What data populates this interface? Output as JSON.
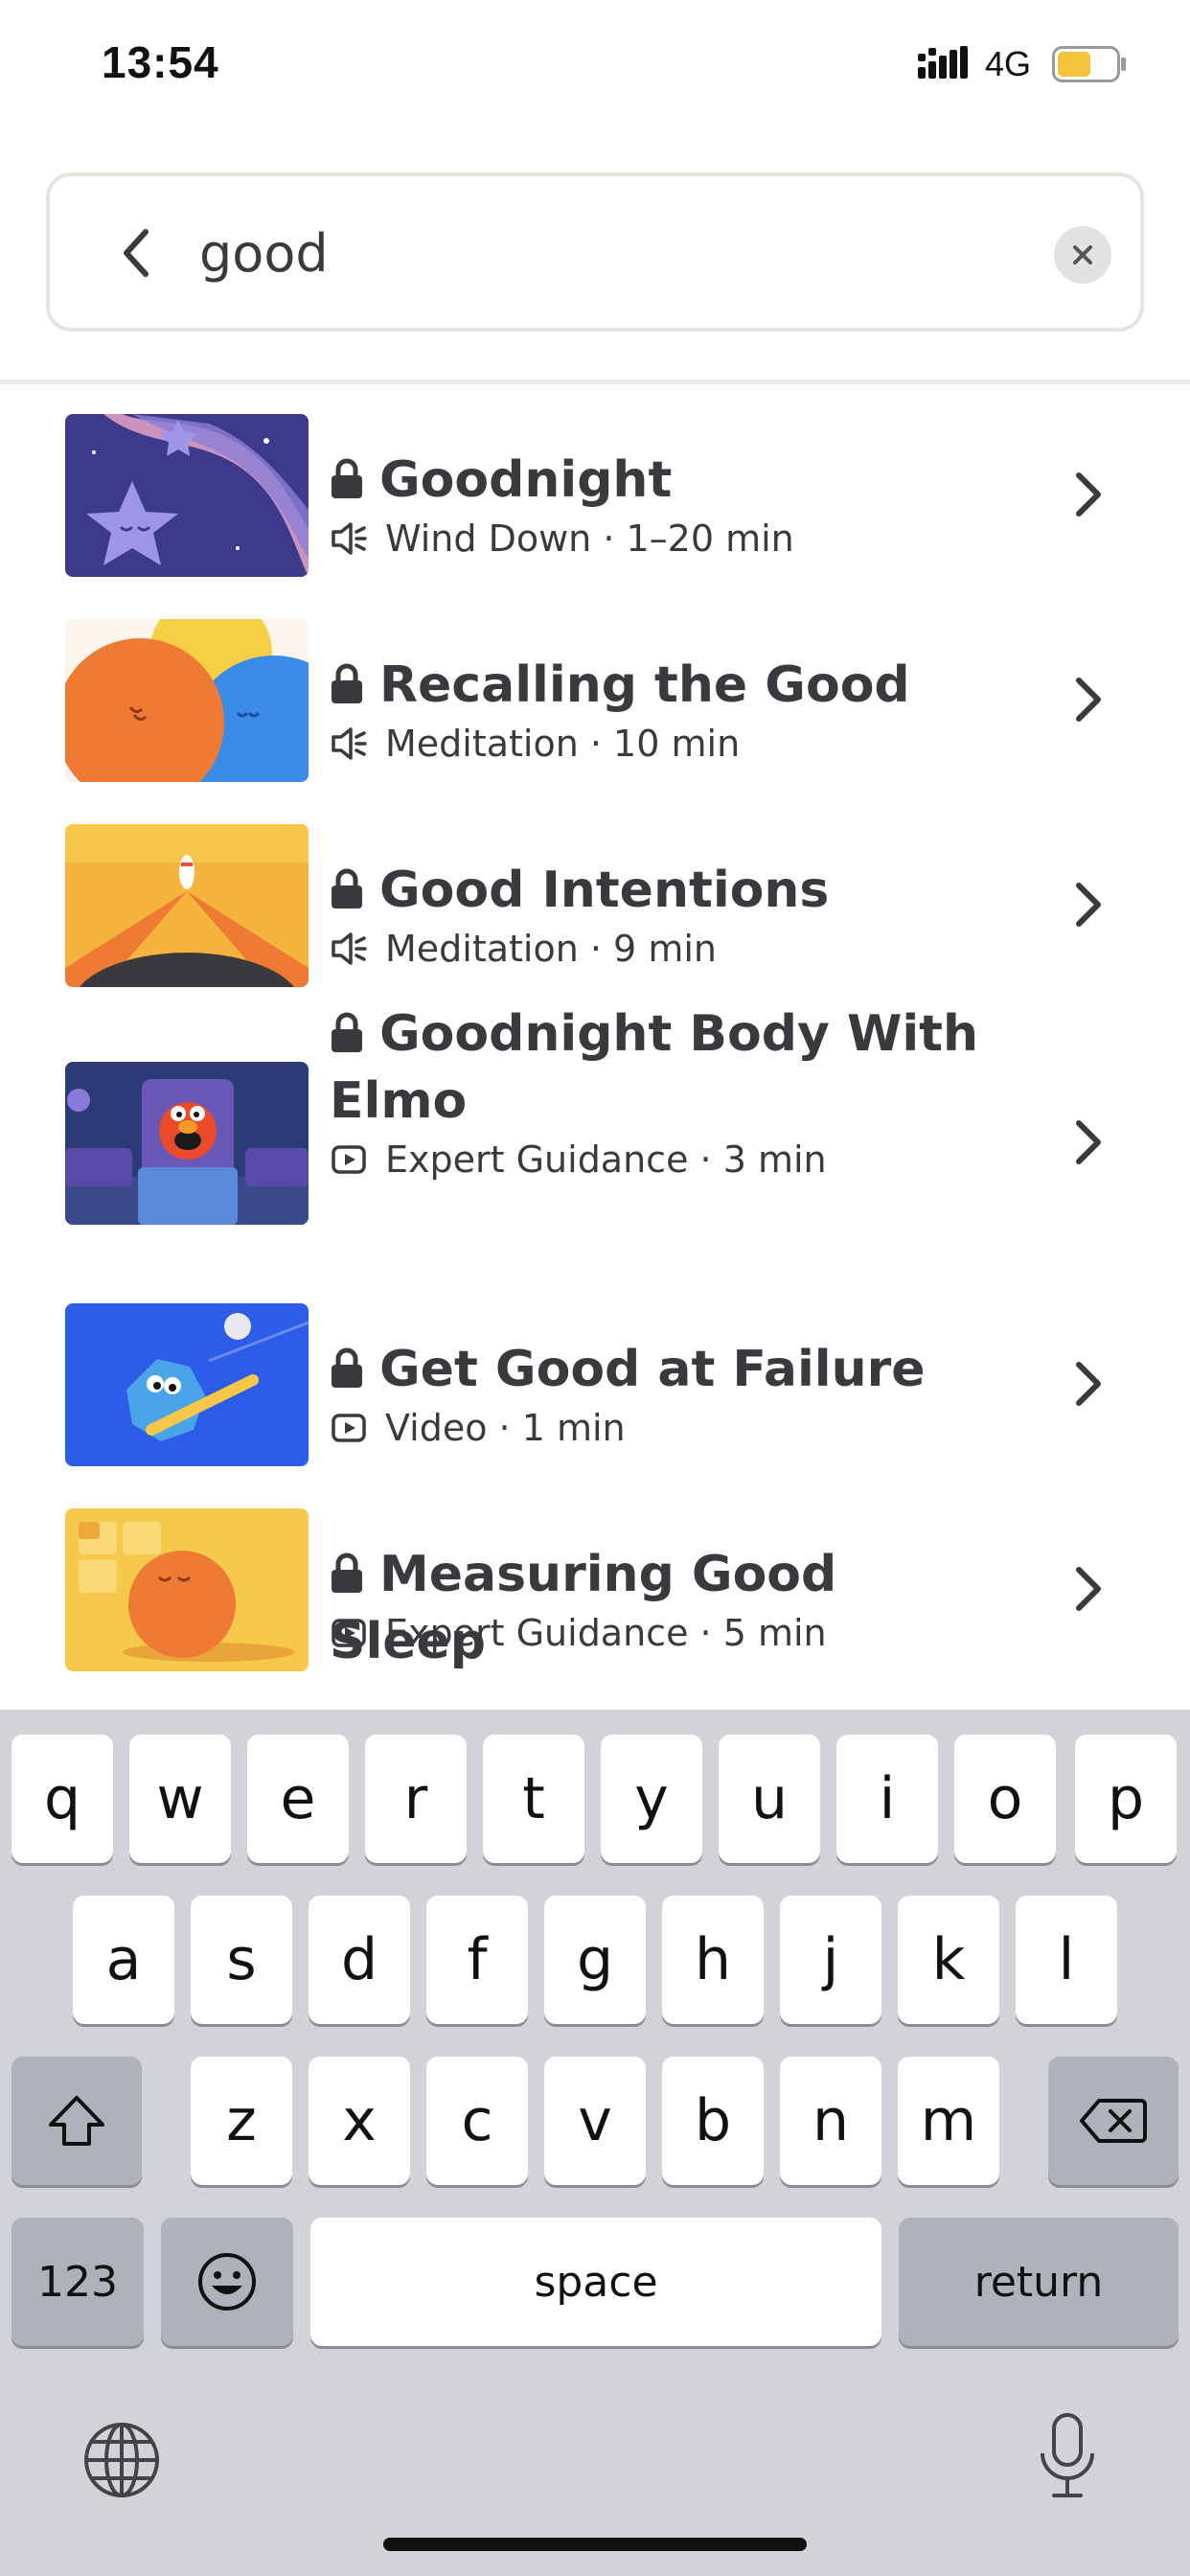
{
  "status_bar": {
    "time": "13:54",
    "network": "4G",
    "battery_color": "#f5c33b"
  },
  "search": {
    "query": "good",
    "back_icon": "chevron-left-icon",
    "clear_icon": "close-icon"
  },
  "results": [
    {
      "title": "Goodnight",
      "type_icon": "speaker-icon",
      "meta": "Wind Down · 1–20 min",
      "locked": true,
      "thumb": "goodnight"
    },
    {
      "title": "Recalling the Good",
      "type_icon": "speaker-icon",
      "meta": "Meditation · 10 min",
      "locked": true,
      "thumb": "recalling"
    },
    {
      "title": "Good Intentions",
      "type_icon": "speaker-icon",
      "meta": "Meditation · 9 min",
      "locked": true,
      "thumb": "intentions"
    },
    {
      "title": "Goodnight Body With Elmo",
      "type_icon": "play-icon",
      "meta": "Expert Guidance · 3 min",
      "locked": true,
      "thumb": "elmo"
    },
    {
      "title": "Get Good at Failure",
      "type_icon": "play-icon",
      "meta": "Video · 1 min",
      "locked": true,
      "thumb": "failure"
    },
    {
      "title": "Measuring Good Sleep",
      "type_icon": "play-icon",
      "meta": "Expert Guidance · 5 min",
      "locked": true,
      "thumb": "sleep"
    }
  ],
  "keyboard": {
    "row1": [
      "q",
      "w",
      "e",
      "r",
      "t",
      "y",
      "u",
      "i",
      "o",
      "p"
    ],
    "row2": [
      "a",
      "s",
      "d",
      "f",
      "g",
      "h",
      "j",
      "k",
      "l"
    ],
    "row3": [
      "z",
      "x",
      "c",
      "v",
      "b",
      "n",
      "m"
    ],
    "numbers_label": "123",
    "space_label": "space",
    "return_label": "return"
  }
}
